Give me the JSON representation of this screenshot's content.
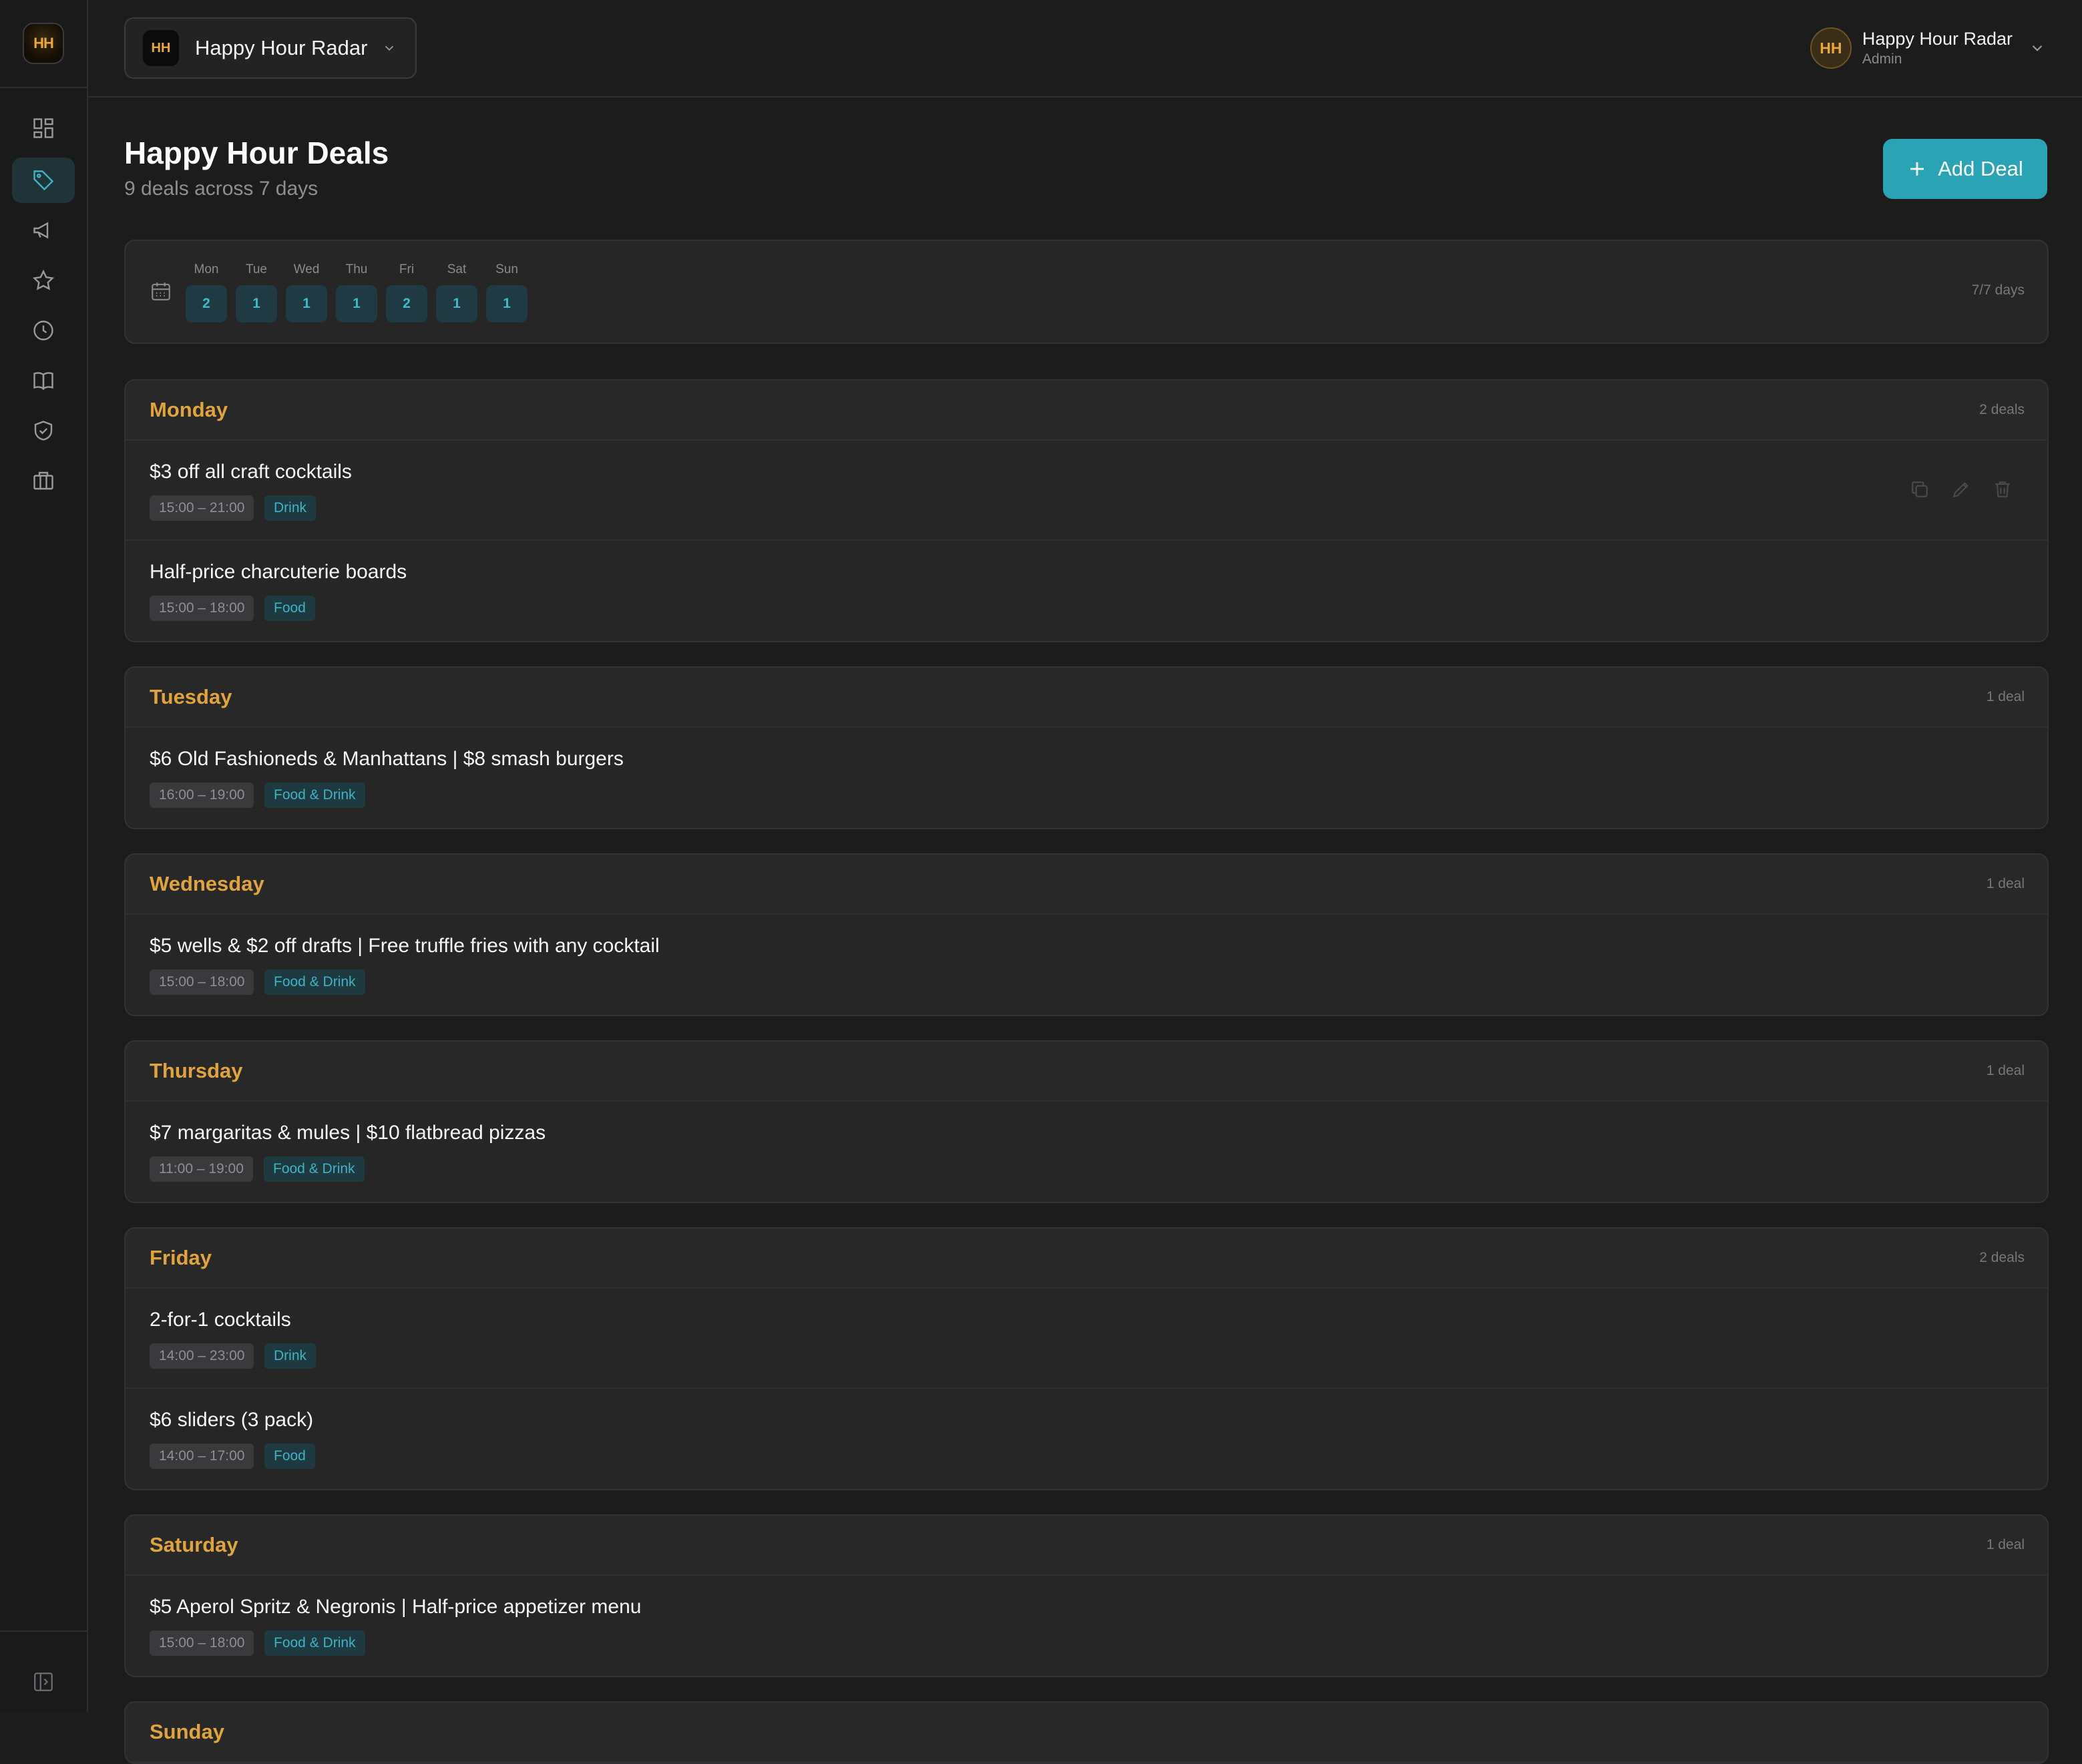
{
  "app": {
    "logo_text": "HH",
    "venue_name": "Happy Hour Radar"
  },
  "user": {
    "initials": "HH",
    "name": "Happy Hour Radar",
    "role": "Admin"
  },
  "sidebar": {
    "items": [
      {
        "icon": "dashboard-icon",
        "active": false
      },
      {
        "icon": "tag-icon",
        "active": true
      },
      {
        "icon": "megaphone-icon",
        "active": false
      },
      {
        "icon": "star-icon",
        "active": false
      },
      {
        "icon": "clock-icon",
        "active": false
      },
      {
        "icon": "book-icon",
        "active": false
      },
      {
        "icon": "shield-check-icon",
        "active": false
      },
      {
        "icon": "briefcase-icon",
        "active": false
      }
    ],
    "collapse_icon": "sidebar-collapse-icon"
  },
  "page": {
    "title": "Happy Hour Deals",
    "subtitle": "9 deals across 7 days",
    "add_button": "Add Deal"
  },
  "week": {
    "days": [
      {
        "label": "Mon",
        "count": "2"
      },
      {
        "label": "Tue",
        "count": "1"
      },
      {
        "label": "Wed",
        "count": "1"
      },
      {
        "label": "Thu",
        "count": "1"
      },
      {
        "label": "Fri",
        "count": "2"
      },
      {
        "label": "Sat",
        "count": "1"
      },
      {
        "label": "Sun",
        "count": "1"
      }
    ],
    "coverage": "7/7 days"
  },
  "days": [
    {
      "name": "Monday",
      "count": "2 deals",
      "deals": [
        {
          "title": "$3 off all craft cocktails",
          "time": "15:00 – 21:00",
          "category": "Drink"
        },
        {
          "title": "Half-price charcuterie boards",
          "time": "15:00 – 18:00",
          "category": "Food"
        }
      ]
    },
    {
      "name": "Tuesday",
      "count": "1 deal",
      "deals": [
        {
          "title": "$6 Old Fashioneds & Manhattans | $8 smash burgers",
          "time": "16:00 – 19:00",
          "category": "Food & Drink"
        }
      ]
    },
    {
      "name": "Wednesday",
      "count": "1 deal",
      "deals": [
        {
          "title": "$5 wells & $2 off drafts | Free truffle fries with any cocktail",
          "time": "15:00 – 18:00",
          "category": "Food & Drink"
        }
      ]
    },
    {
      "name": "Thursday",
      "count": "1 deal",
      "deals": [
        {
          "title": "$7 margaritas & mules | $10 flatbread pizzas",
          "time": "11:00 – 19:00",
          "category": "Food & Drink"
        }
      ]
    },
    {
      "name": "Friday",
      "count": "2 deals",
      "deals": [
        {
          "title": "2-for-1 cocktails",
          "time": "14:00 – 23:00",
          "category": "Drink"
        },
        {
          "title": "$6 sliders (3 pack)",
          "time": "14:00 – 17:00",
          "category": "Food"
        }
      ]
    },
    {
      "name": "Saturday",
      "count": "1 deal",
      "deals": [
        {
          "title": "$5 Aperol Spritz & Negronis | Half-price appetizer menu",
          "time": "15:00 – 18:00",
          "category": "Food & Drink"
        }
      ]
    },
    {
      "name": "Sunday",
      "count": "",
      "deals": []
    }
  ],
  "colors": {
    "accent": "#2aa3b5",
    "day_heading": "#e0a43c",
    "background": "#1c1c1d",
    "card": "#262627"
  }
}
